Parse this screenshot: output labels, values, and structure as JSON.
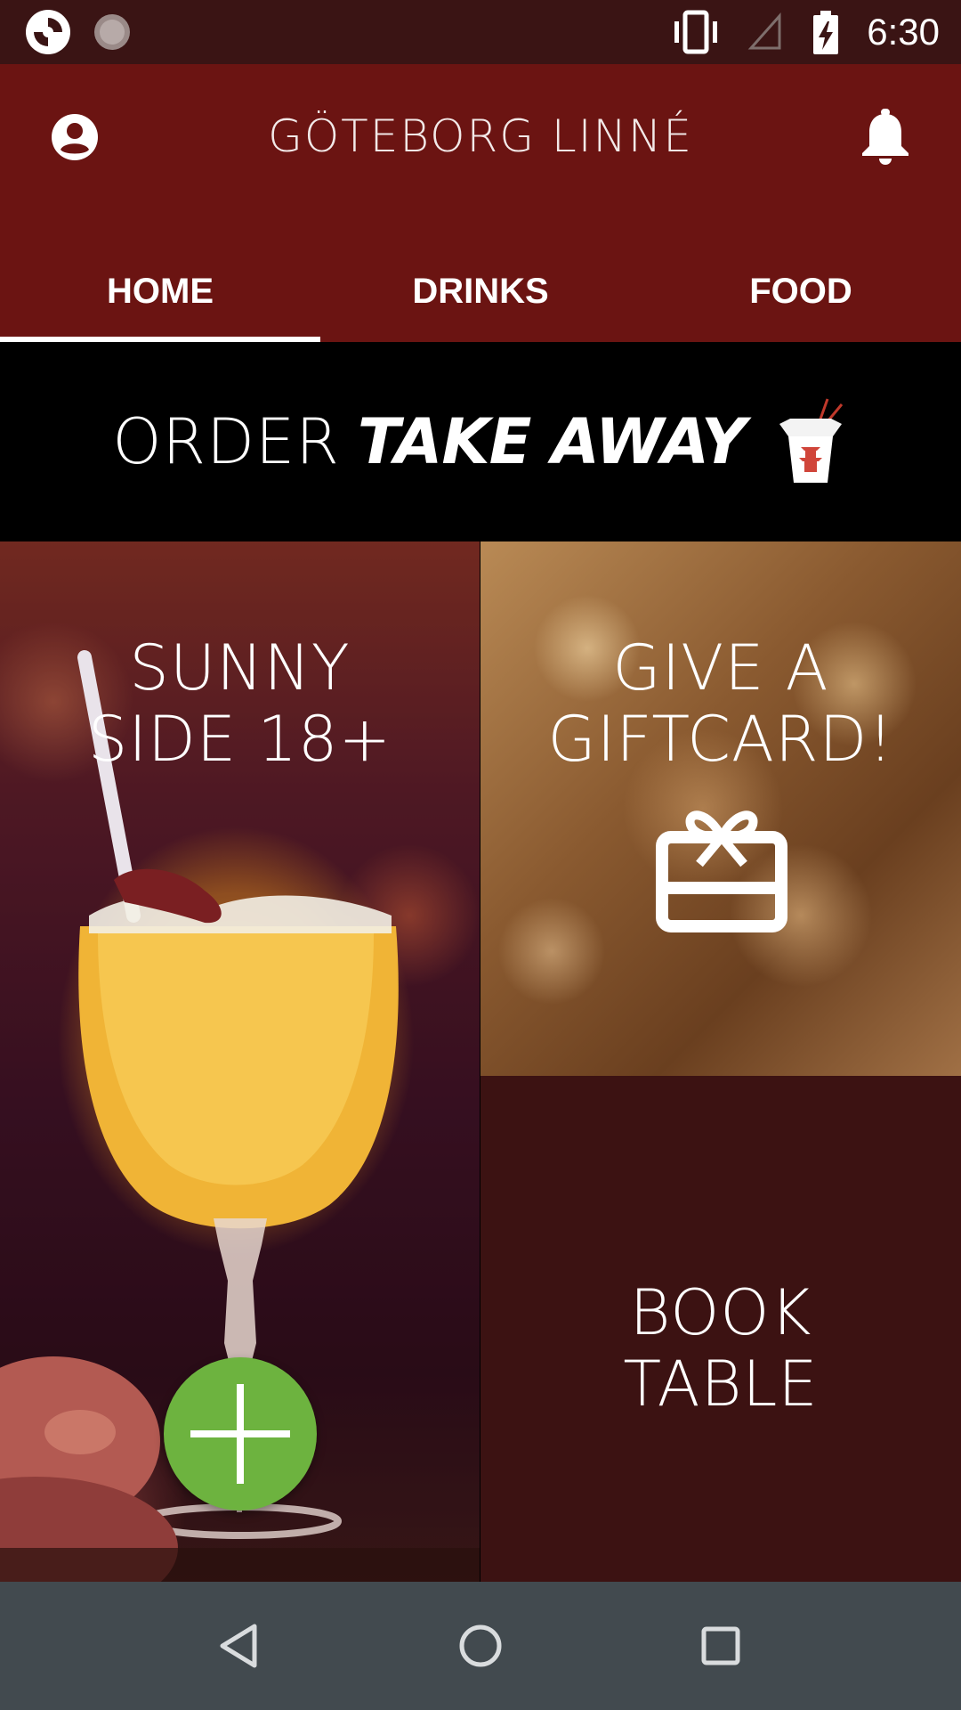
{
  "status_bar": {
    "time": "6:30",
    "icons": [
      "app-notification-icon",
      "loading-notification-icon",
      "vibrate-icon",
      "no-signal-icon",
      "battery-charging-icon"
    ]
  },
  "app_bar": {
    "title": "GÖTEBORG LINNÉ",
    "left_icon": "account-circle-icon",
    "right_icon": "bell-icon"
  },
  "tabs": [
    {
      "label": "HOME",
      "selected": true
    },
    {
      "label": "DRINKS",
      "selected": false
    },
    {
      "label": "FOOD",
      "selected": false
    }
  ],
  "banner": {
    "order": "ORDER",
    "take_away": "TAKE AWAY",
    "icon": "takeaway-box-icon"
  },
  "tiles": {
    "sunny": {
      "line1": "SUNNY",
      "line2": "SIDE 18+"
    },
    "gift": {
      "line1": "GIVE A",
      "line2": "GIFTCARD!",
      "icon": "giftcard-icon"
    },
    "book": {
      "line1": "BOOK",
      "line2": "TABLE"
    }
  },
  "fab": {
    "icon": "plus-icon",
    "color": "#6db33f"
  },
  "nav_bar": {
    "icons": [
      "back-icon",
      "home-icon",
      "recents-icon"
    ]
  },
  "colors": {
    "status_bar": "#3a1414",
    "app_bar": "#6b1412",
    "book_tile": "#3c1212",
    "nav_bar": "#424a4f"
  }
}
